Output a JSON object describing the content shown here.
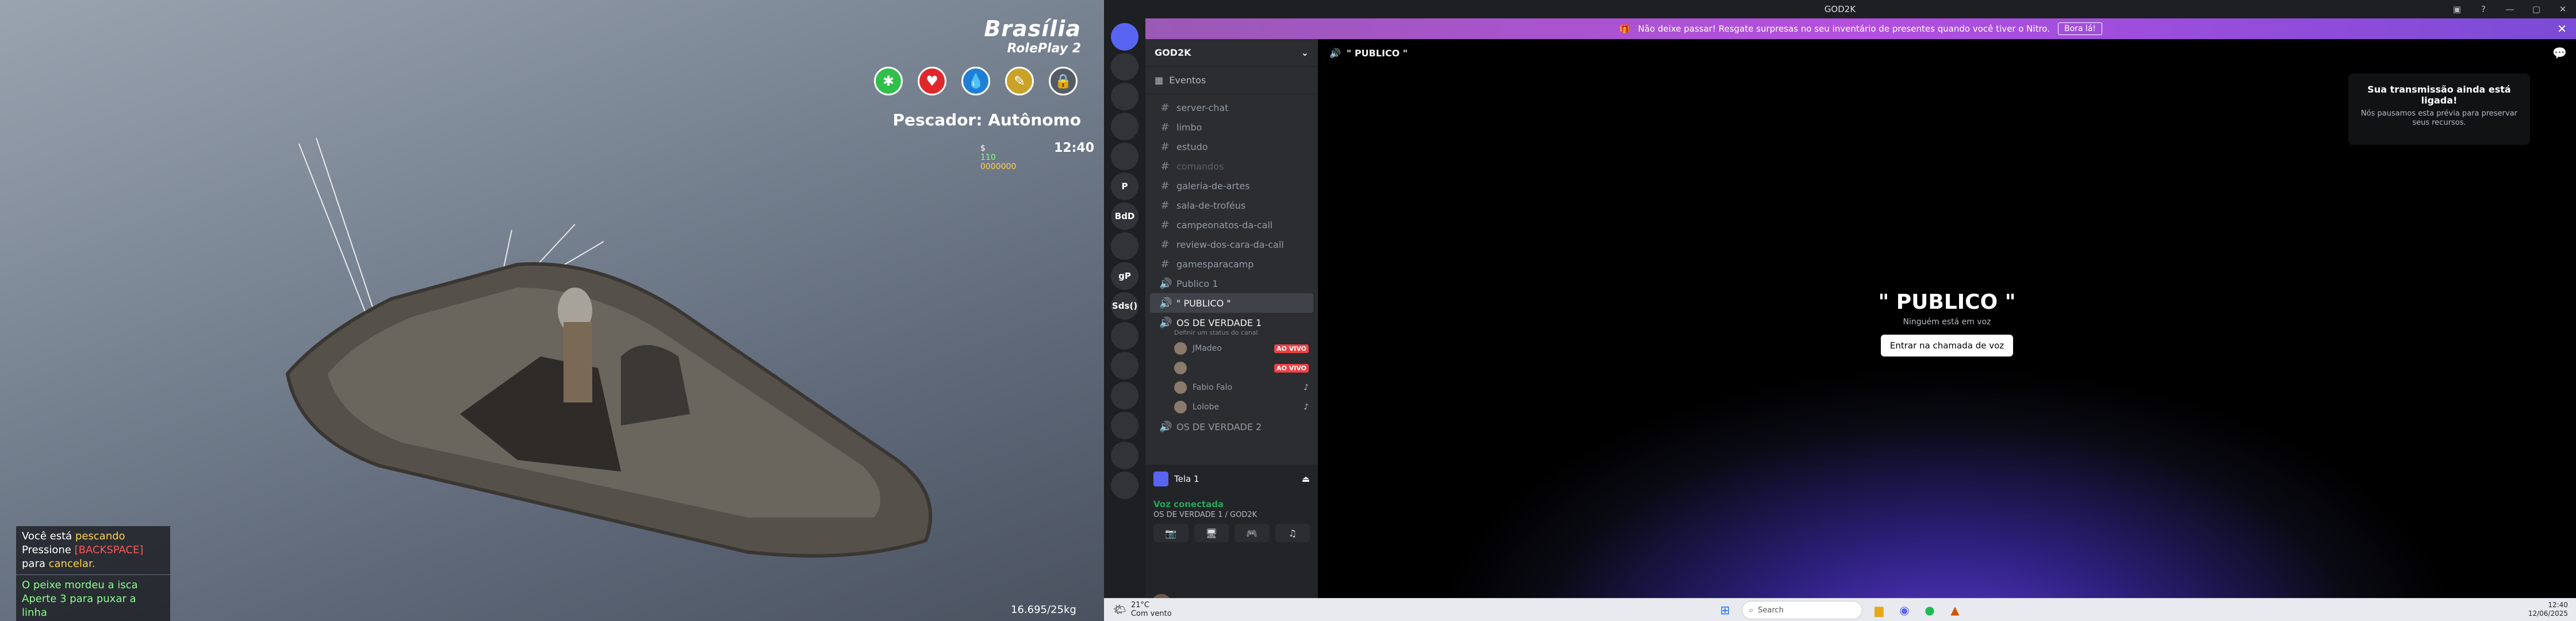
{
  "game": {
    "logo_line1": "Brasília",
    "logo_line2": "RolePlay 2",
    "job": "Pescador: Autônomo",
    "clock": "12:40",
    "mini": [
      "$",
      "110",
      "0000000"
    ],
    "notif1": {
      "a": "Você está ",
      "b": "pescando",
      "c": "Pressione ",
      "d": "[BACKSPACE]",
      "e": " para ",
      "f": "cancelar."
    },
    "notif2": {
      "a": "O peixe mordeu a isca",
      "b": "Aperte 3 para puxar a linha"
    },
    "weight": "16.695/25kg",
    "stats": [
      {
        "name": "stamina-icon",
        "color": "#2fbf4a",
        "glyph": "✱"
      },
      {
        "name": "health-icon",
        "color": "#e0282c",
        "glyph": "♥"
      },
      {
        "name": "thirst-icon",
        "color": "#1f7fd6",
        "glyph": "💧"
      },
      {
        "name": "hunger-icon",
        "color": "#c9a227",
        "glyph": "✎"
      },
      {
        "name": "lock-icon",
        "color": "#555b66",
        "glyph": "🔒"
      }
    ]
  },
  "discord": {
    "title": "GOD2K",
    "banner_text": "Não deixe passar! Resgate surpresas no seu inventário de presentes quando você tiver o Nitro.",
    "banner_button": "Bora lá!",
    "rail_servers": [
      "",
      "",
      "",
      "",
      "",
      "P",
      "BdD",
      "",
      "gP",
      "Sds()",
      "",
      "",
      "",
      "",
      "",
      ""
    ],
    "server_name": "GOD2K",
    "events": "Eventos",
    "channels": [
      {
        "icon": "#",
        "label": "server-chat",
        "style": ""
      },
      {
        "icon": "#",
        "label": "limbo",
        "style": ""
      },
      {
        "icon": "#",
        "label": "estudo",
        "style": ""
      },
      {
        "icon": "#",
        "label": "comandos",
        "style": "muted"
      },
      {
        "icon": "#",
        "label": "galeria-de-artes",
        "style": ""
      },
      {
        "icon": "#",
        "label": "sala-de-troféus",
        "style": ""
      },
      {
        "icon": "#",
        "label": "campeonatos-da-call",
        "style": ""
      },
      {
        "icon": "#",
        "label": "review-dos-cara-da-call",
        "style": ""
      },
      {
        "icon": "#",
        "label": "gamesparacamp",
        "style": ""
      },
      {
        "icon": "🔊",
        "label": "Publico 1",
        "style": ""
      },
      {
        "icon": "🔊",
        "label": "\" PUBLICO \"",
        "style": "active"
      },
      {
        "icon": "🔊",
        "label": "OS DE VERDADE 1",
        "style": "bold"
      }
    ],
    "channel_status": "Definir um status do canal",
    "voice_users": [
      {
        "name": "JMadeo",
        "badge": "AO VIVO"
      },
      {
        "name": "",
        "badge": "AO VIVO"
      },
      {
        "name": "Fabio Falo",
        "badge": ""
      },
      {
        "name": "Lolobe",
        "badge": ""
      }
    ],
    "last_channel": "OS DE VERDADE 2",
    "tela": "Tela 1",
    "voice_status": "Voz conectada",
    "voice_location": "OS DE VERDADE 1 / GOD2K",
    "main_header": "\" PUBLICO \"",
    "center_title": "\" PUBLICO \"",
    "center_sub": "Ninguém está em voz",
    "join_button": "Entrar na chamada de voz",
    "toast_title": "Sua transmissão ainda está ligada!",
    "toast_body": "Nós pausamos esta prévia para preservar seus recursos."
  },
  "taskbar": {
    "temp": "21°C",
    "weather": "Com vento",
    "search": "Search",
    "time": "12:40",
    "date": "12/06/2025"
  }
}
